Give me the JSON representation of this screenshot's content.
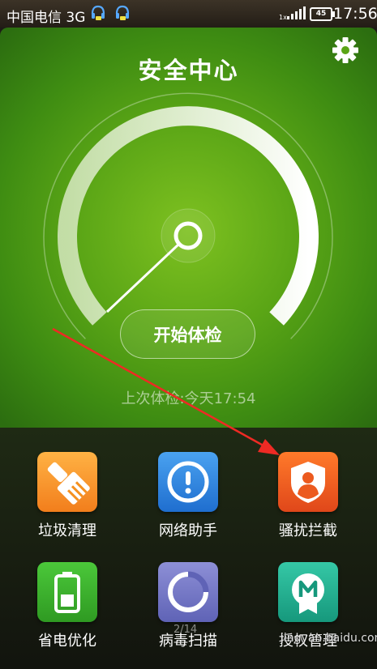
{
  "status_bar": {
    "carrier": "中国电信 3G",
    "network_label": "1x",
    "battery": "45",
    "time": "17:56"
  },
  "header": {
    "title": "安全中心"
  },
  "main": {
    "check_button": "开始体检",
    "last_check": "上次体检:今天17:54"
  },
  "tools": [
    {
      "label": "垃圾清理",
      "icon": "broom-icon",
      "color": "#f5901f"
    },
    {
      "label": "网络助手",
      "icon": "alert-circle-icon",
      "color": "#2b7fdc"
    },
    {
      "label": "骚扰拦截",
      "icon": "shield-person-icon",
      "color": "#ec5a1f"
    },
    {
      "label": "省电优化",
      "icon": "battery-icon",
      "color": "#38a928"
    },
    {
      "label": "病毒扫描",
      "icon": "scan-ring-icon",
      "color": "#7073c4"
    },
    {
      "label": "授权管理",
      "icon": "badge-m-icon",
      "color": "#1fae8c"
    }
  ],
  "pager": "2/14",
  "watermark": "jingyan.baidu.com"
}
